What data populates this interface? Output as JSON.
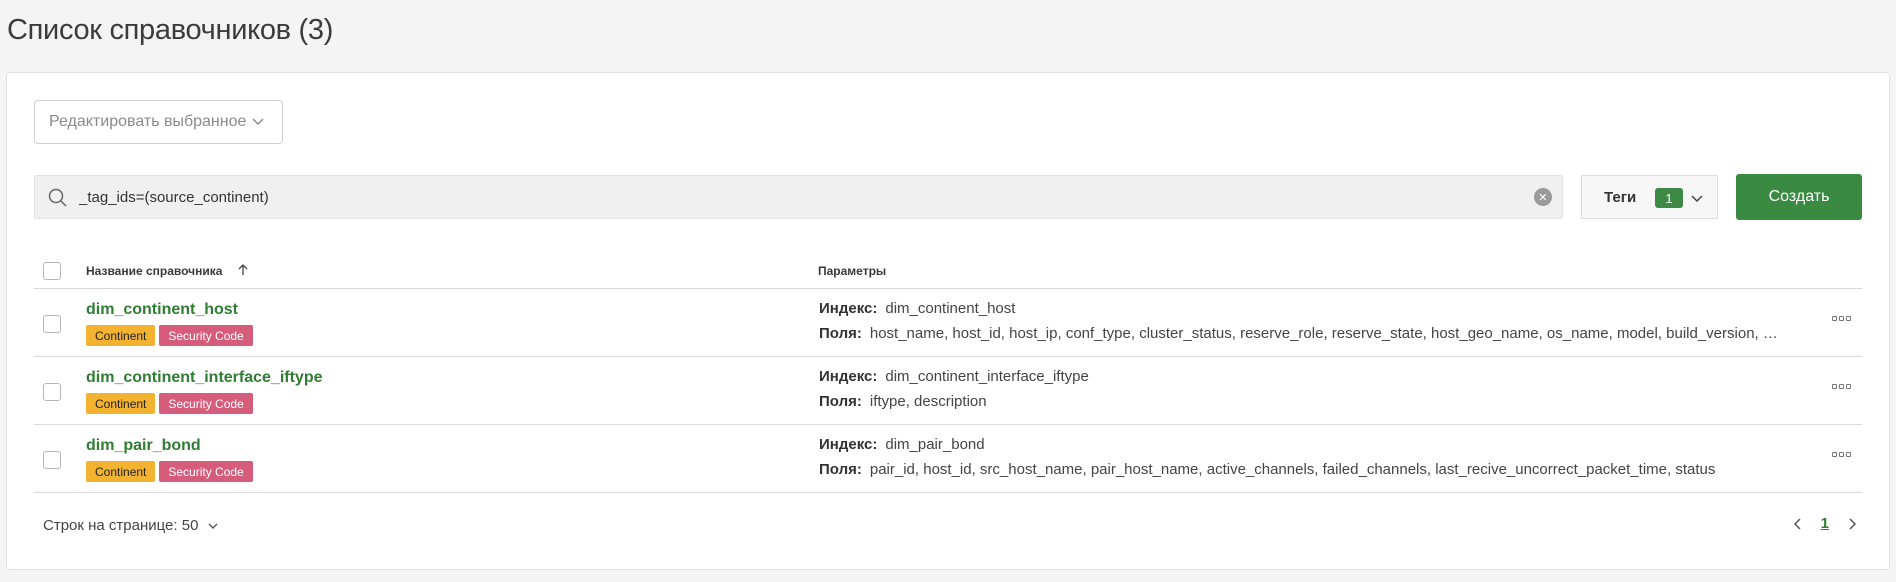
{
  "page": {
    "title": "Список справочников (3)"
  },
  "toolbar": {
    "bulk_edit_label": "Редактировать выбранное",
    "search_value": "_tag_ids=(source_continent)",
    "tags_label": "Теги",
    "tags_count": "1",
    "create_label": "Создать"
  },
  "table": {
    "col_name": "Название справочника",
    "col_params": "Параметры",
    "index_label": "Индекс:",
    "fields_label": "Поля:",
    "rows": [
      {
        "name": "dim_continent_host",
        "tags": [
          "Continent",
          "Security Code"
        ],
        "index": "dim_continent_host",
        "fields": "host_name, host_id, host_ip, conf_type, cluster_status, reserve_role, reserve_state, host_geo_name, os_name, model, build_version, conf_version, c..."
      },
      {
        "name": "dim_continent_interface_iftype",
        "tags": [
          "Continent",
          "Security Code"
        ],
        "index": "dim_continent_interface_iftype",
        "fields": "iftype, description"
      },
      {
        "name": "dim_pair_bond",
        "tags": [
          "Continent",
          "Security Code"
        ],
        "index": "dim_pair_bond",
        "fields": "pair_id, host_id, src_host_name, pair_host_name, active_channels, failed_channels, last_recive_uncorrect_packet_time, status"
      }
    ]
  },
  "footer": {
    "rows_per_page_label": "Строк на странице: 50",
    "current_page": "1"
  },
  "colors": {
    "accent": "#3a8a42",
    "tag_continent": "#f3b330",
    "tag_security": "#d65c7c",
    "link": "#2f7d32"
  }
}
